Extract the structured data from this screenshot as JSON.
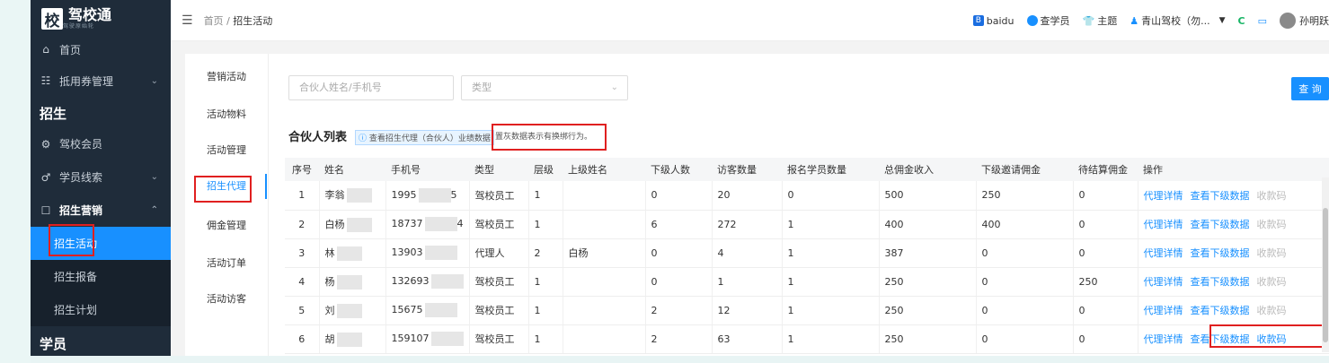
{
  "sidebar": {
    "logo_char": "校",
    "logo_text": "驾校通",
    "logo_sub": "驾驶原始轮",
    "items": [
      {
        "icon": "home-icon",
        "label": "首页"
      },
      {
        "icon": "coupon-icon",
        "label": "抵用券管理"
      }
    ],
    "section_recruit": "招生",
    "recruit_items": [
      {
        "icon": "gear-icon",
        "label": "驾校会员"
      },
      {
        "icon": "person-icon",
        "label": "学员线索"
      }
    ],
    "recruit_marketing": "招生营销",
    "marketing_subs": [
      "招生活动",
      "招生报备",
      "招生计划"
    ],
    "section_student": "学员"
  },
  "topbar": {
    "breadcrumb_home": "首页",
    "breadcrumb_sep": "/",
    "breadcrumb_current": "招生活动",
    "baidu": "baidu",
    "check_student": "查学员",
    "theme": "主题",
    "school": "青山驾校（勿...",
    "user": "孙明跃"
  },
  "tabs": [
    "营销活动",
    "活动物料",
    "活动管理",
    "招生代理",
    "佣金管理",
    "活动订单",
    "活动访客"
  ],
  "active_tab": "招生代理",
  "search": {
    "name_placeholder": "合伙人姓名/手机号",
    "type_placeholder": "类型",
    "query_label": "查 询"
  },
  "list": {
    "title": "合伙人列表",
    "info_text": "查看招生代理（合伙人）业绩数据",
    "red_note": "置灰数据表示有换绑行为。"
  },
  "table": {
    "headers": [
      "序号",
      "姓名",
      "手机号",
      "类型",
      "层级",
      "上级姓名",
      "下级人数",
      "访客数量",
      "报名学员数量",
      "总佣金收入",
      "下级邀请佣金",
      "待结算佣金",
      "操作"
    ],
    "rows": [
      {
        "no": "1",
        "name": "李翁",
        "phone_a": "1995",
        "phone_b": "5",
        "type": "驾校员工",
        "level": "1",
        "parent": "",
        "subs": "0",
        "visitors": "20",
        "signups": "0",
        "total": "500",
        "invite": "250",
        "pending": "0"
      },
      {
        "no": "2",
        "name": "白杨",
        "phone_a": "18737",
        "phone_b": "4",
        "type": "驾校员工",
        "level": "1",
        "parent": "",
        "subs": "6",
        "visitors": "272",
        "signups": "1",
        "total": "400",
        "invite": "400",
        "pending": "0"
      },
      {
        "no": "3",
        "name": "林",
        "phone_a": "13903",
        "phone_b": "",
        "type": "代理人",
        "level": "2",
        "parent": "白杨",
        "subs": "0",
        "visitors": "4",
        "signups": "1",
        "total": "387",
        "invite": "0",
        "pending": "0"
      },
      {
        "no": "4",
        "name": "杨",
        "phone_a": "132693",
        "phone_b": "",
        "type": "驾校员工",
        "level": "1",
        "parent": "",
        "subs": "0",
        "visitors": "1",
        "signups": "1",
        "total": "250",
        "invite": "0",
        "pending": "250"
      },
      {
        "no": "5",
        "name": "刘",
        "phone_a": "15675",
        "phone_b": "",
        "type": "驾校员工",
        "level": "1",
        "parent": "",
        "subs": "2",
        "visitors": "12",
        "signups": "1",
        "total": "250",
        "invite": "0",
        "pending": "0"
      },
      {
        "no": "6",
        "name": "胡",
        "phone_a": "159107",
        "phone_b": "",
        "type": "驾校员工",
        "level": "1",
        "parent": "",
        "subs": "2",
        "visitors": "63",
        "signups": "1",
        "total": "250",
        "invite": "0",
        "pending": "0"
      }
    ],
    "op_detail": "代理详情",
    "op_sub": "查看下级数据",
    "op_qr": "收款码"
  }
}
